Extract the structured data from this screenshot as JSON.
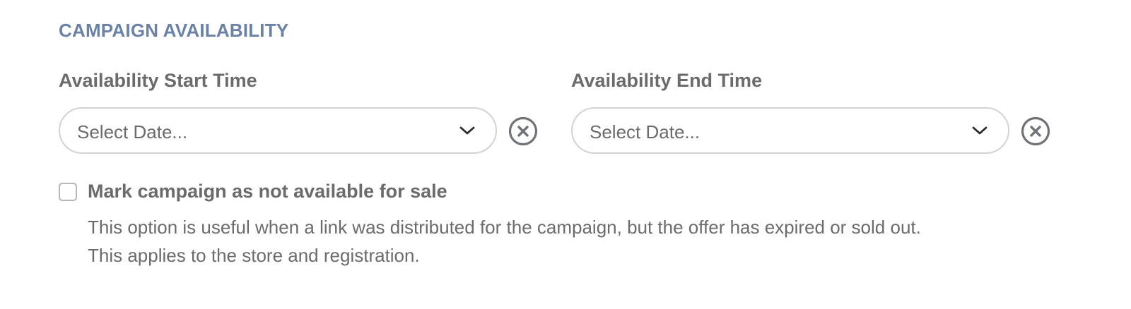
{
  "section": {
    "title": "CAMPAIGN AVAILABILITY"
  },
  "start_time": {
    "label": "Availability Start Time",
    "placeholder": "Select Date...",
    "value": ""
  },
  "end_time": {
    "label": "Availability End Time",
    "placeholder": "Select Date...",
    "value": ""
  },
  "not_available": {
    "label": "Mark campaign as not available for sale",
    "checked": false,
    "help_line_1": "This option is useful when a link was distributed for the campaign, but the offer has expired or sold out.",
    "help_line_2": "This applies to the store and registration."
  },
  "icons": {
    "dropdown": "chevron-down-icon",
    "clear": "clear-circle-x-icon"
  },
  "colors": {
    "section_title": "#6a82a8",
    "text": "#6b6b6b",
    "border": "#d3d3d3",
    "icon": "#6e7278"
  }
}
